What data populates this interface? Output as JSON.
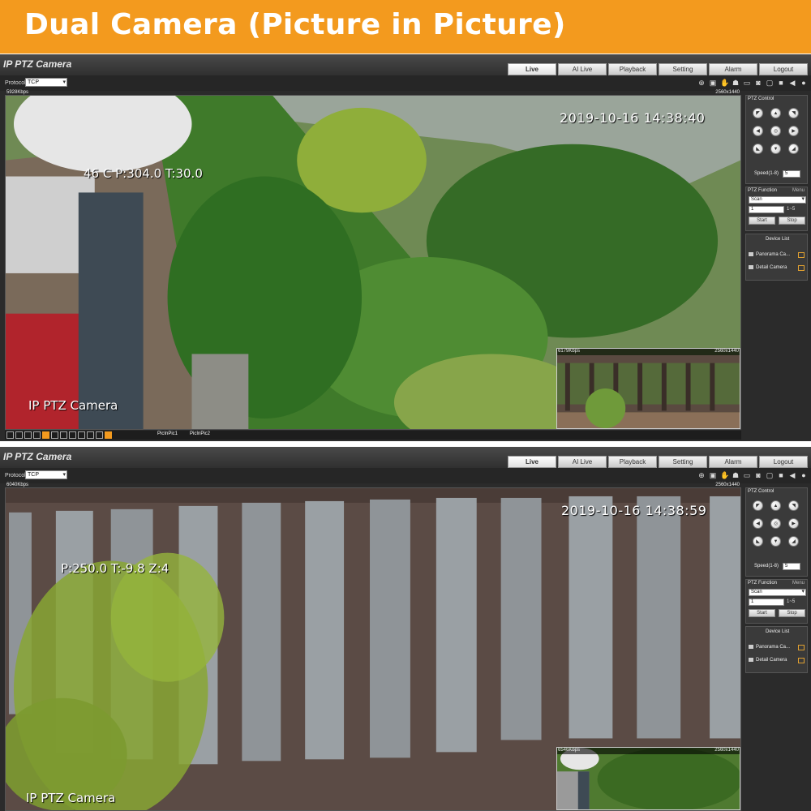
{
  "banner": {
    "title": "Dual Camera (Picture in Picture)"
  },
  "colors": {
    "banner": "#f39a1e",
    "chrome": "#2b2b2b"
  },
  "screens": [
    {
      "app_title": "IP PTZ Camera",
      "tabs": [
        "Live",
        "AI Live",
        "Playback",
        "Setting",
        "Alarm",
        "Logout"
      ],
      "active_tab": "Live",
      "protocol_label": "Protocol",
      "protocol_value": "TCP",
      "main_bitrate": "5928Kbps",
      "main_resolution": "2560x1440",
      "osd_time": "2019-10-16 14:38:40",
      "osd_ptz": "46 C P:304.0 T:30.0",
      "osd_camera": "IP PTZ Camera",
      "pip_bitrate": "6179Kbps",
      "pip_resolution": "2560x1440",
      "pip_options": [
        "PicInPic1",
        "PicInPic2"
      ],
      "ptz": {
        "title": "PTZ Control",
        "speed_label": "Speed(1-8)",
        "speed_value": "5",
        "function_title": "PTZ Function",
        "menu_label": "Menu",
        "function_value": "Scan",
        "number_value": "1",
        "range_label": "1~5",
        "start_label": "Start",
        "stop_label": "Stop"
      },
      "device_list": {
        "title": "Device List",
        "items": [
          "Panorama Ca...",
          "Detail Camera"
        ]
      }
    },
    {
      "app_title": "IP PTZ Camera",
      "tabs": [
        "Live",
        "AI Live",
        "Playback",
        "Setting",
        "Alarm",
        "Logout"
      ],
      "active_tab": "Live",
      "protocol_label": "Protocol",
      "protocol_value": "TCP",
      "main_bitrate": "6040Kbps",
      "main_resolution": "2560x1440",
      "osd_time": "2019-10-16 14:38:59",
      "osd_ptz": "P:250.0 T:-9.8 Z:4",
      "osd_camera": "IP PTZ Camera",
      "pip_bitrate": "6546Kbps",
      "pip_resolution": "2560x1440",
      "ptz": {
        "title": "PTZ Control",
        "speed_label": "Speed(1-8)",
        "speed_value": "5",
        "function_title": "PTZ Function",
        "menu_label": "Menu",
        "function_value": "Scan",
        "number_value": "1",
        "range_label": "1~5",
        "start_label": "Start",
        "stop_label": "Stop"
      },
      "device_list": {
        "title": "Device List",
        "items": [
          "Panorama Ca...",
          "Detail Camera"
        ]
      }
    }
  ]
}
